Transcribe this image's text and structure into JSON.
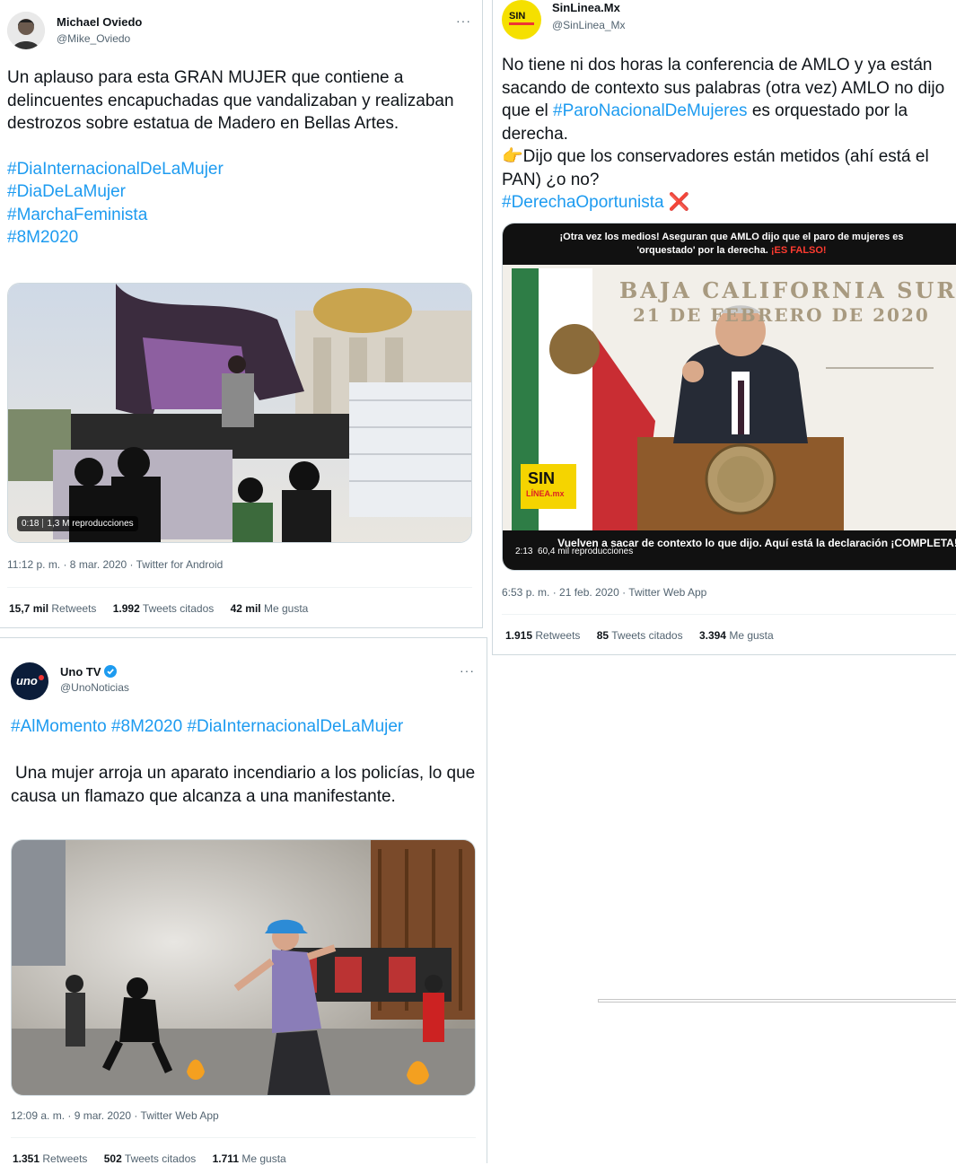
{
  "tweets": [
    {
      "author_name": "Michael Oviedo",
      "handle": "@Mike_Oviedo",
      "more": "···",
      "text": "Un aplauso para esta GRAN MUJER que contiene a delincuentes encapuchadas que vandalizaban y realizaban destrozos sobre estatua de Madero en Bellas Artes.",
      "hashtags": [
        "#DiaInternacionalDeLaMujer",
        "#DiaDeLaMujer",
        "#MarchaFeminista",
        "#8M2020"
      ],
      "video_duration": "0:18",
      "video_views": "1,3 M reproducciones",
      "timestamp": "11:12 p. m. · 8 mar. 2020 · Twitter for Android",
      "retweets": "15,7 mil",
      "retweets_label": "Retweets",
      "quotes": "1.992",
      "quotes_label": "Tweets citados",
      "likes": "42 mil",
      "likes_label": "Me gusta"
    },
    {
      "author_name": "SinLinea.Mx",
      "handle": "@SinLinea_Mx",
      "avatar_text": "SIN",
      "text_lines": [
        "No tiene ni dos horas la conferencia de AMLO y ya están sacando de contexto sus palabras (otra vez) AMLO no dijo que el ",
        "#ParoNacionalDeMujeres",
        " es orquestado por la derecha.",
        "👉",
        "Dijo que los conservadores están metidos (ahí está el PAN) ¿o no?",
        "#DerechaOportunista",
        "❌"
      ],
      "video_top_caption": "¡Otra vez los medios! Aseguran que AMLO dijo que el paro de mujeres es 'orquestado' por la derecha.",
      "video_top_caption_red": "¡ES FALSO!",
      "video_backdrop_line1": "BAJA CALIFORNIA SUR",
      "video_backdrop_line2": "21 DE FEBRERO DE 2020",
      "video_logo": "SIN",
      "video_logo_sub": "LÍNEA.mx",
      "video_bottom_caption": "Vuelven a sacar de contexto lo que dijo. Aquí está la declaración ¡COMPLETA!",
      "video_duration": "2:13",
      "video_views": "60,4 mil reproducciones",
      "timestamp": "6:53 p. m. · 21 feb. 2020 · Twitter Web App",
      "retweets": "1.915",
      "retweets_label": "Retweets",
      "quotes": "85",
      "quotes_label": "Tweets citados",
      "likes": "3.394",
      "likes_label": "Me gusta"
    },
    {
      "author_name": "Uno TV",
      "handle": "@UnoNoticias",
      "avatar_text": "uno",
      "more": "···",
      "hashtag_line": "#AlMomento #8M2020 #DiaInternacionalDeLaMujer",
      "text": "Una mujer arroja un aparato incendiario a los policías, lo que causa un flamazo que alcanza a una manifestante.",
      "timestamp": "12:09 a. m. · 9 mar. 2020 · Twitter Web App",
      "retweets": "1.351",
      "retweets_label": "Retweets",
      "quotes": "502",
      "quotes_label": "Tweets citados",
      "likes": "1.711",
      "likes_label": "Me gusta"
    }
  ],
  "colors": {
    "link": "#1d9bf0",
    "verified": "#1d9bf0",
    "muted": "#536471"
  }
}
